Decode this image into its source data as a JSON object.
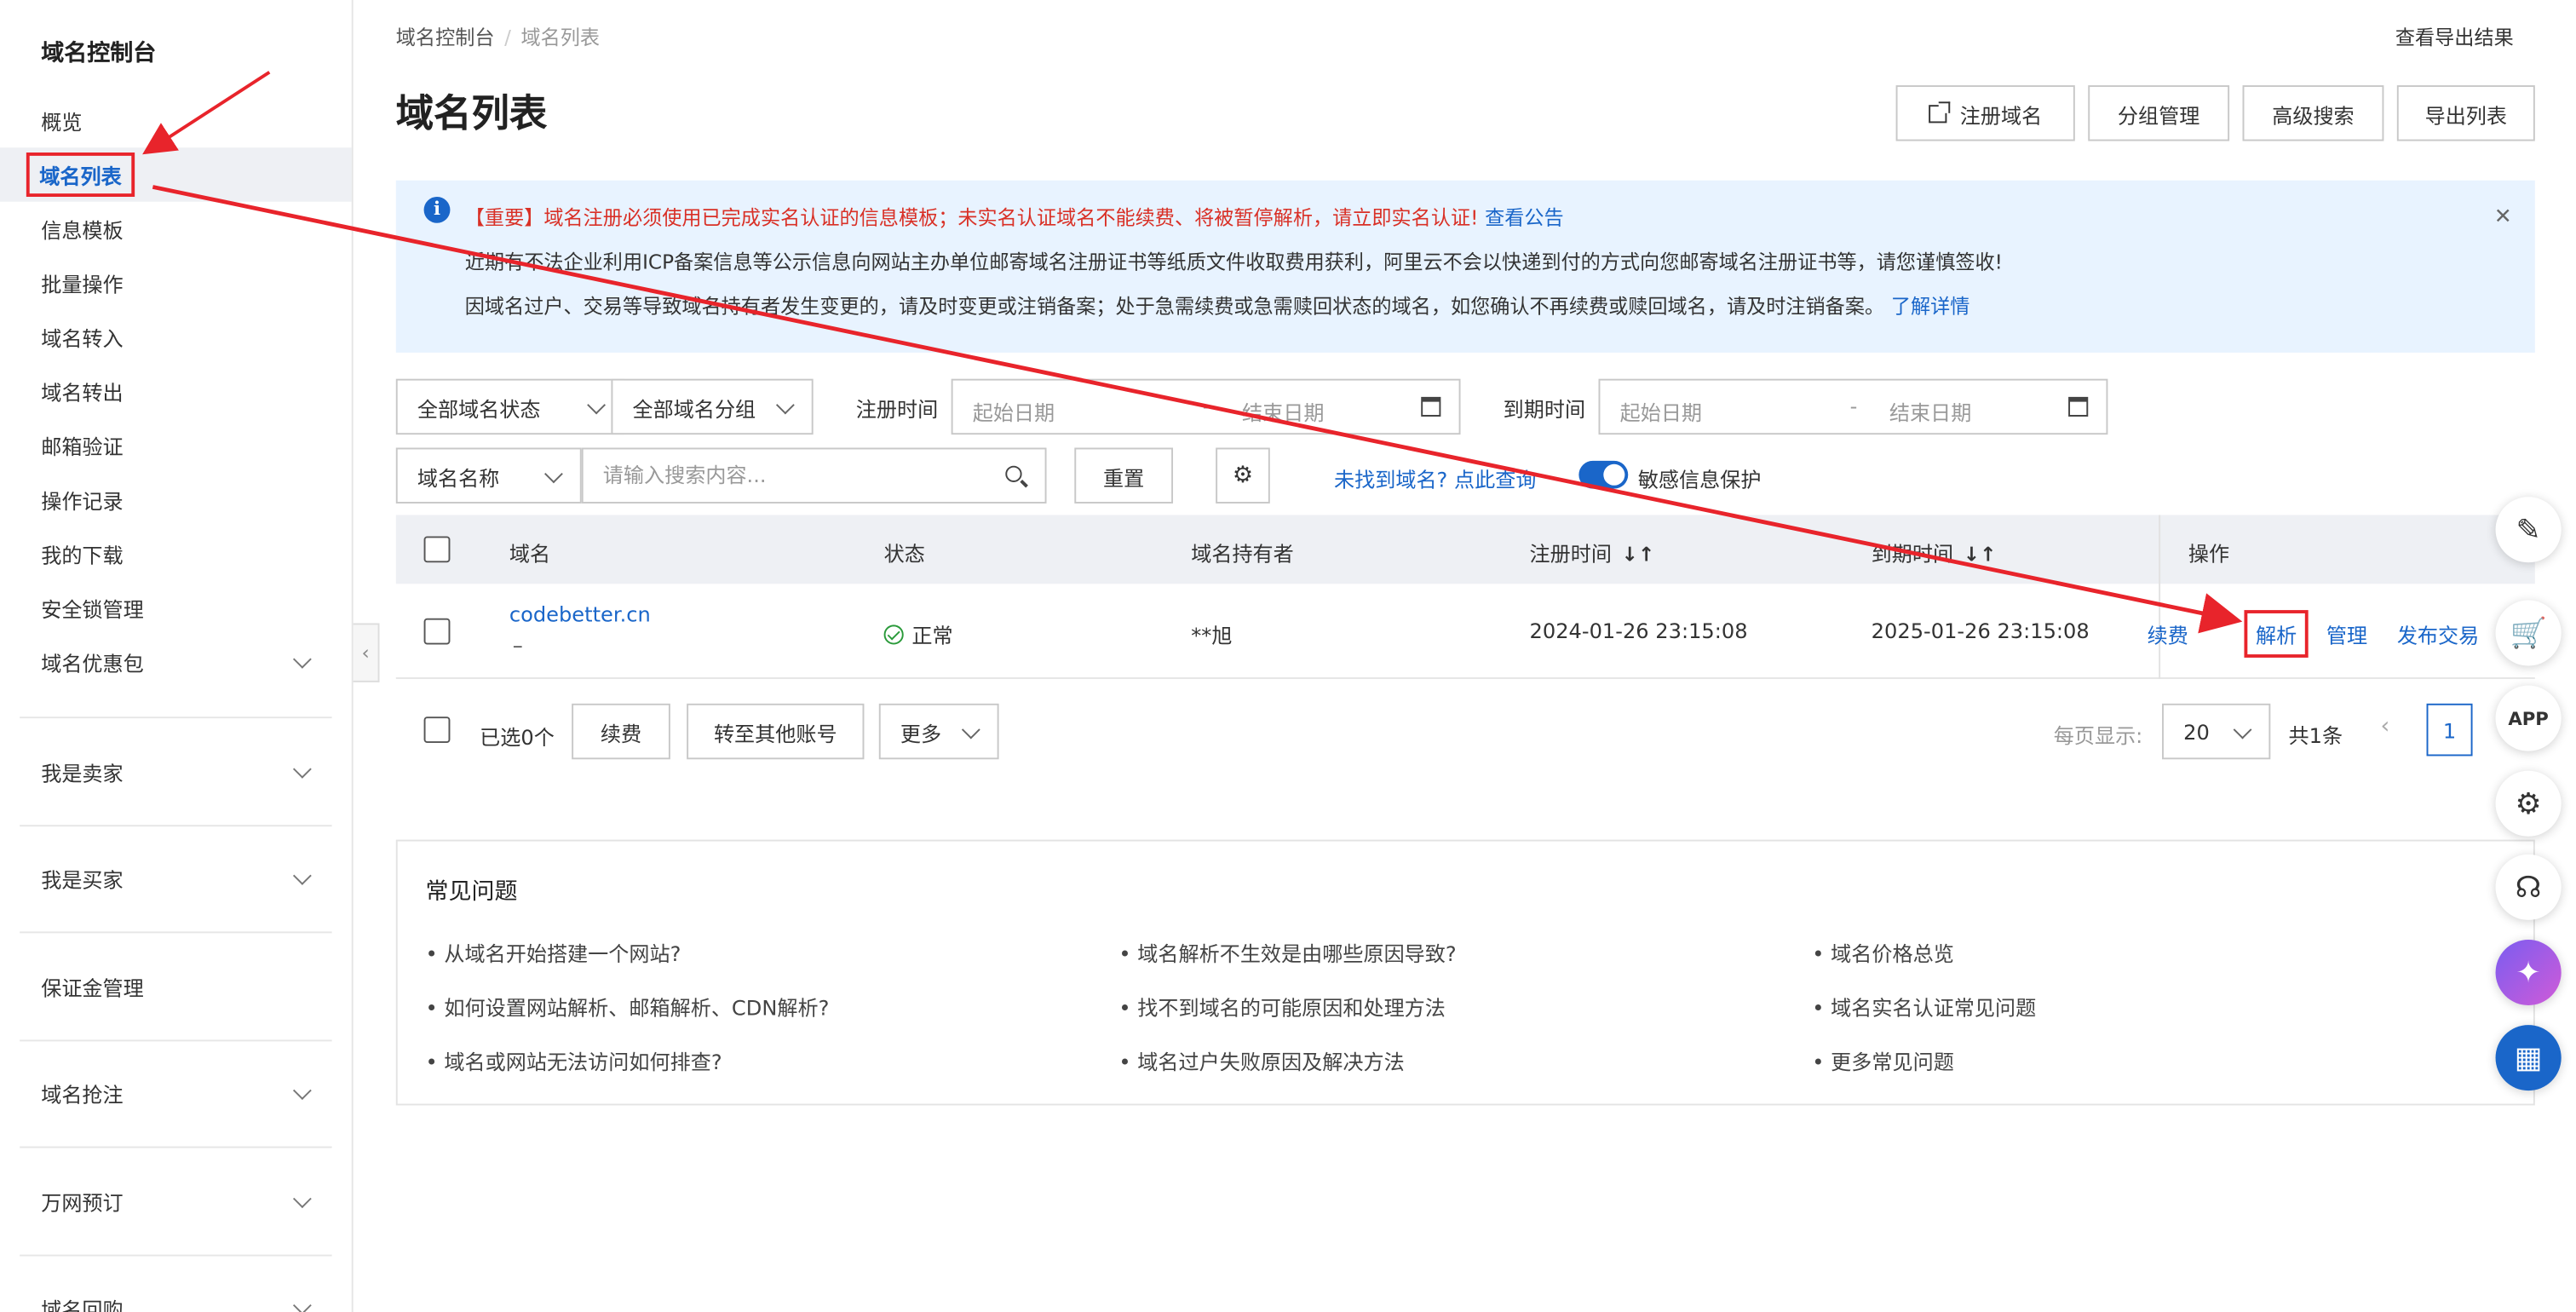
{
  "sidebar": {
    "title": "域名控制台",
    "items": [
      {
        "label": "概览"
      },
      {
        "label": "域名列表"
      },
      {
        "label": "信息模板"
      },
      {
        "label": "批量操作"
      },
      {
        "label": "域名转入"
      },
      {
        "label": "域名转出"
      },
      {
        "label": "邮箱验证"
      },
      {
        "label": "操作记录"
      },
      {
        "label": "我的下载"
      },
      {
        "label": "安全锁管理"
      },
      {
        "label": "域名优惠包"
      }
    ],
    "groups": [
      {
        "label": "我是卖家"
      },
      {
        "label": "我是买家"
      },
      {
        "label": "保证金管理"
      },
      {
        "label": "域名抢注"
      },
      {
        "label": "万网预订"
      },
      {
        "label": "域名回购"
      }
    ]
  },
  "header": {
    "breadcrumb": [
      "域名控制台",
      "域名列表"
    ],
    "export_link": "查看导出结果",
    "title": "域名列表",
    "buttons": {
      "register": "注册域名",
      "groups": "分组管理",
      "advanced": "高级搜索",
      "export": "导出列表"
    }
  },
  "notice": {
    "line1": "【重要】域名注册必须使用已完成实名认证的信息模板；未实名认证域名不能续费、将被暂停解析，请立即实名认证!",
    "line1_link": "查看公告",
    "line2": "近期有不法企业利用ICP备案信息等公示信息向网站主办单位邮寄域名注册证书等纸质文件收取费用获利，阿里云不会以快递到付的方式向您邮寄域名注册证书等，请您谨慎签收!",
    "line3": "因域名过户、交易等导致域名持有者发生变更的，请及时变更或注销备案；处于急需续费或急需赎回状态的域名，如您确认不再续费或赎回域名，请及时注销备案。",
    "line3_link": "了解详情"
  },
  "filters": {
    "status": "全部域名状态",
    "group": "全部域名分组",
    "reg_time_label": "注册时间",
    "exp_time_label": "到期时间",
    "start_placeholder": "起始日期",
    "end_placeholder": "结束日期",
    "dash": "-",
    "field": "域名名称",
    "search_placeholder": "请输入搜索内容...",
    "reset": "重置",
    "not_found_link": "未找到域名? 点此查询",
    "privacy_label": "敏感信息保护"
  },
  "table": {
    "headers": {
      "domain": "域名",
      "status": "状态",
      "owner": "域名持有者",
      "reg_time": "注册时间",
      "exp_time": "到期时间",
      "ops": "操作"
    },
    "rows": [
      {
        "domain": "codebetter.cn",
        "sub": "–",
        "status": "正常",
        "owner": "**旭",
        "reg_time": "2024-01-26 23:15:08",
        "exp_time": "2025-01-26 23:15:08",
        "ops": [
          "续费",
          "解析",
          "管理",
          "发布交易"
        ]
      }
    ]
  },
  "bulk": {
    "selected": "已选0个",
    "renew": "续费",
    "transfer": "转至其他账号",
    "more": "更多"
  },
  "pagination": {
    "per_page_label": "每页显示:",
    "per_page": "20",
    "total": "共1条",
    "current": "1"
  },
  "faq": {
    "title": "常见问题",
    "items": [
      "从域名开始搭建一个网站?",
      "域名解析不生效是由哪些原因导致?",
      "域名价格总览",
      "如何设置网站解析、邮箱解析、CDN解析?",
      "找不到域名的可能原因和处理方法",
      "域名实名认证常见问题",
      "域名或网站无法访问如何排查?",
      "域名过户失败原因及解决方法",
      "更多常见问题"
    ]
  },
  "floating_icons": [
    "edit-icon",
    "cart-icon",
    "app-icon",
    "settings-icon",
    "headset-icon",
    "ai-assistant-icon",
    "apps-grid-icon"
  ],
  "colors": {
    "accent": "#1a66c9",
    "highlight": "#e8242b",
    "notice_bg": "#e8f3ff",
    "warning_text": "#d93026"
  }
}
